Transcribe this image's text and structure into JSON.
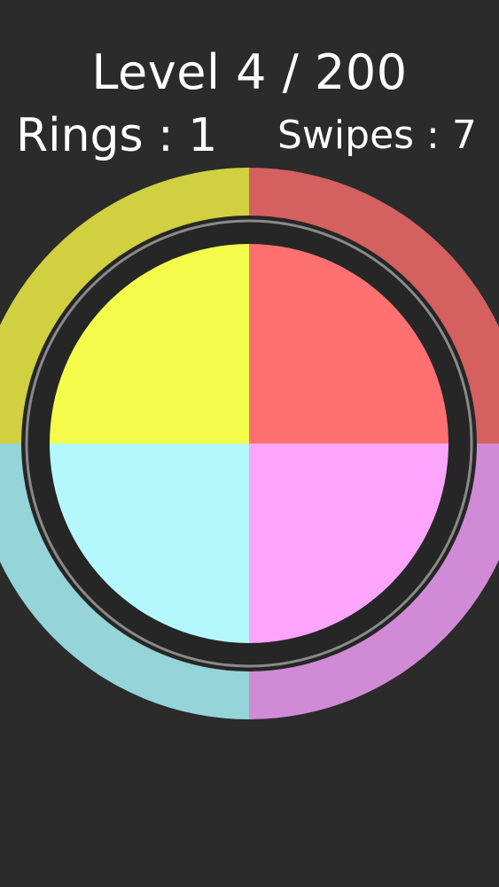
{
  "hud": {
    "level_text": "Level 4 / 200",
    "rings_text": "Rings : 1",
    "swipes_text": "Swipes : 7"
  },
  "colors": {
    "background": "#2b2b2b",
    "ring_gap": "#262626",
    "ring_separator": "#8a8a8a",
    "outer_top_left": "#d0d040",
    "outer_top_right": "#d46060",
    "outer_bottom_left": "#95d4d8",
    "outer_bottom_right": "#d18ad6",
    "inner_top_left": "#f5fb4a",
    "inner_top_right": "#ff7171",
    "inner_bottom_left": "#b4f8fd",
    "inner_bottom_right": "#fda4fd"
  },
  "board": {
    "outer_quadrants": [
      "outer-quadrant-top-left",
      "outer-quadrant-top-right",
      "outer-quadrant-bottom-left",
      "outer-quadrant-bottom-right"
    ],
    "inner_quadrants": [
      "inner-quadrant-top-left",
      "inner-quadrant-top-right",
      "inner-quadrant-bottom-left",
      "inner-quadrant-bottom-right"
    ]
  }
}
